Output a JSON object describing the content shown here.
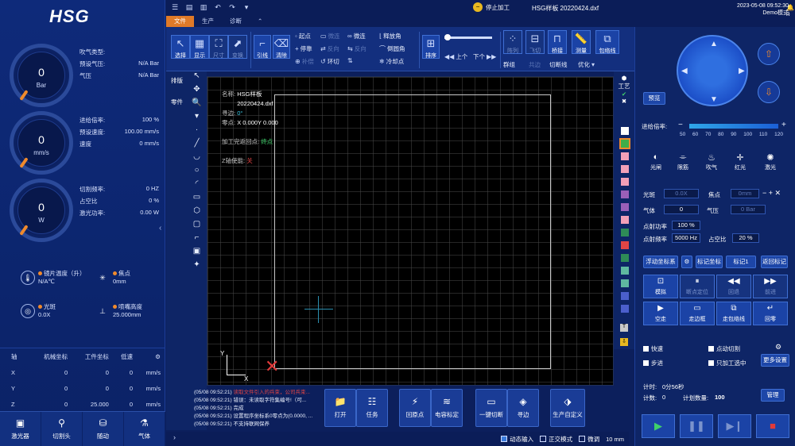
{
  "app": {
    "logo": "HSG",
    "stop_label": "停止加工",
    "filename": "HSG样板 20220424.dxf",
    "alarm_a": "0",
    "alarm_b": "0",
    "datetime": "2023-05-08 09:52:30",
    "mode": "Demo模式"
  },
  "tabs": [
    "文件",
    "生产",
    "诊断"
  ],
  "ribbon": {
    "select": "选择",
    "display": "显示",
    "size": "尺寸",
    "transform": "变换",
    "lead": "引线",
    "clear": "清除",
    "start_point": "起点",
    "micro_joint": "微连",
    "reverse_cut": "释放角",
    "stop_point": "停靠",
    "reverse": "反向",
    "round_corner": "倒圆角",
    "compensate": "补偿",
    "ring_cut": "环切",
    "cool_point": "冷却点",
    "sort": "排序",
    "prev": "上个",
    "next": "下个",
    "array": "阵列",
    "fly_cut": "飞切",
    "bridge": "桥接",
    "measure": "测量",
    "nest_line": "包络线",
    "group": "群组",
    "common_edge": "共边",
    "break_line": "切断线",
    "optimize": "优化"
  },
  "vtabs": [
    "排版",
    "零件"
  ],
  "gauges": [
    {
      "value": "0",
      "unit": "Bar"
    },
    {
      "value": "0",
      "unit": "mm/s"
    },
    {
      "value": "0",
      "unit": "W"
    }
  ],
  "gas": {
    "title": "吹气类型:",
    "preset_label": "预设气压:",
    "preset_value": "N/A Bar",
    "pressure_label": "气压",
    "pressure_value": "N/A Bar"
  },
  "feed": {
    "rate_label": "进给倍率:",
    "rate_value": "100 %",
    "preset_label": "预设速度:",
    "preset_value": "100.00 mm/s",
    "speed_label": "速度",
    "speed_value": "0 mm/s"
  },
  "laser": {
    "freq_label": "切割频率:",
    "freq_value": "0 HZ",
    "duty_label": "占空比",
    "duty_value": "0 %",
    "power_label": "激光功率:",
    "power_value": "0.00 W"
  },
  "sensors": {
    "lens_temp_label": "镜片温度（升）",
    "lens_temp_value": "N/A℃",
    "focus_label": "焦点",
    "focus_value": "0mm",
    "spot_label": "光斑",
    "spot_value": "0.0X",
    "nozzle_label": "喷嘴高度",
    "nozzle_value": "25.000mm"
  },
  "coord": {
    "headers": [
      "轴",
      "机械坐标",
      "工件坐标",
      "低速"
    ],
    "rows": [
      [
        "X",
        "0",
        "0",
        "0",
        "mm/s"
      ],
      [
        "Y",
        "0",
        "0",
        "0",
        "mm/s"
      ],
      [
        "Z",
        "0",
        "25.000",
        "0",
        "mm/s"
      ]
    ]
  },
  "leftnav": [
    "激光器",
    "切割头",
    "随动",
    "气体"
  ],
  "canvas": {
    "name_label": "名称:",
    "name_value": "HSG样板\n20220424.dxf",
    "seek_label": "寻边:",
    "seek_value": "0°",
    "zero_label": "零点:",
    "zero_value": "X 0.000Y 0.000",
    "return_label": "加工完返回点:",
    "return_value": "终点",
    "z_label": "Z轴使能:",
    "z_value": "关",
    "axis_x": "X",
    "axis_y": "Y"
  },
  "layers": {
    "header": "工艺",
    "colors": [
      "#ffffff",
      "#3fae49",
      "#f2a0b8",
      "#f2a0b8",
      "#f2a0b8",
      "#9a5fb8",
      "#9a5fb8",
      "#f2a0b8",
      "#2e8b57",
      "#e04545",
      "#2e8b57",
      "#5fb8a0",
      "#5fb8a0",
      "#4b5fcc",
      "#4b5fcc"
    ]
  },
  "log": [
    {
      "t": "(05/08 09:52:21)",
      "m": "读取文件引入的兵束，公司兵束...",
      "red": true
    },
    {
      "t": "(05/08 09:52:21)",
      "m": "错误：未读取字符集编号!（可...",
      "red": false
    },
    {
      "t": "(05/08 09:52:21)",
      "m": "完成",
      "red": false
    },
    {
      "t": "(05/08 09:52:21)",
      "m": "设置程序坐标系0零点为(0.0000, ...",
      "red": false
    },
    {
      "t": "(05/08 09:52:21)",
      "m": "不支持联网保养",
      "red": false
    }
  ],
  "actions": [
    "打开",
    "任务",
    "回原点",
    "电容标定",
    "一键切断",
    "寻边",
    "生产自定义"
  ],
  "bottom": {
    "dynamic_input": "动态输入",
    "ortho": "正交模式",
    "snap": "微调",
    "step": "10 mm"
  },
  "right": {
    "preview": "预览",
    "feed_label": "进给倍率:",
    "ticks": [
      "50",
      "60",
      "70",
      "80",
      "90",
      "100",
      "110",
      "120"
    ],
    "toggles": [
      "光闸",
      "限筋",
      "吹气",
      "红光",
      "激光"
    ],
    "spot_label": "光斑",
    "spot_value": "0.0X",
    "focus_label": "焦点",
    "focus_value": "0mm",
    "gas_label": "气体",
    "gas_value": "0",
    "pressure_label": "气压",
    "pressure_value": "0 Bar",
    "dot_power_label": "点射功率",
    "dot_power_value": "100 %",
    "dot_freq_label": "点射频率",
    "dot_freq_value": "5000 Hz",
    "duty_label": "占空比",
    "duty_value": "20 %",
    "float_coord": "浮动坐标系",
    "mark_coord": "标记坐标",
    "mark1": "标记1",
    "return_mark": "返回标记",
    "btn_row1": [
      "模拟",
      "断点定位",
      "回退",
      "前进"
    ],
    "btn_row2": [
      "空走",
      "走边框",
      "走包络线",
      "回零"
    ],
    "quick": "快速",
    "point_cut": "点动切割",
    "step": "步进",
    "only_selected": "只加工选中",
    "more": "更多设置",
    "timer_label": "计时:",
    "timer_value": "0分56秒",
    "count_label": "计数:",
    "count_value": "0",
    "plan_label": "计划数量:",
    "plan_value": "100",
    "manage": "管理"
  }
}
